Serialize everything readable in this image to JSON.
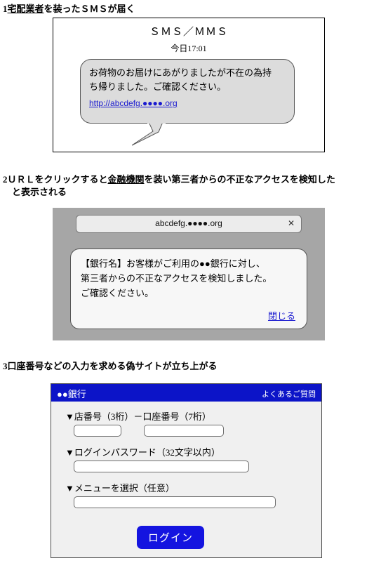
{
  "steps": {
    "step1": {
      "number": "1",
      "text_before": "",
      "underlined": "宅配業者",
      "text_after": "を装ったＳＭＳが届く"
    },
    "step2": {
      "number": "2",
      "text_before": "ＵＲＬをクリックすると",
      "underlined": "金融機関",
      "text_after": "を装い第三者からの不正なアクセスを検知した",
      "line2": "と表示される"
    },
    "step3": {
      "number": "3",
      "text": "口座番号などの入力を求める偽サイトが立ち上がる"
    }
  },
  "sms": {
    "title": "ＳＭＳ／ＭＭＳ",
    "timestamp": "今日17:01",
    "body_line1": "お荷物のお届けにあがりましたが不在の為持",
    "body_line2": "ち帰りました。ご確認ください。",
    "link": "http://abcdefg.●●●●.org"
  },
  "browser": {
    "tab_url": "abcdefg.●●●●.org",
    "close_icon": "✕",
    "dialog_line1": "【銀行名】お客様がご利用の●●銀行に対し、",
    "dialog_line2": "第三者からの不正なアクセスを検知しました。",
    "dialog_line3": "ご確認ください。",
    "close_link": "閉じる"
  },
  "bank": {
    "name": "●●銀行",
    "faq_label": "よくあるご質問",
    "label_account": "▼店番号（3桁）－口座番号（7桁）",
    "label_password": "▼ログインパスワード（32文字以内）",
    "label_menu": "▼メニューを選択（任意）",
    "input_branch_value": "",
    "input_account_value": "",
    "input_password_value": "",
    "input_menu_value": "",
    "login_label": "ログイン"
  },
  "colors": {
    "link_blue": "#1a1ad0",
    "bank_header_blue": "#0c14c8",
    "login_button_blue": "#1414e0",
    "browser_chrome_gray": "#a6a6a6",
    "bubble_gray": "#dcdcdc"
  }
}
